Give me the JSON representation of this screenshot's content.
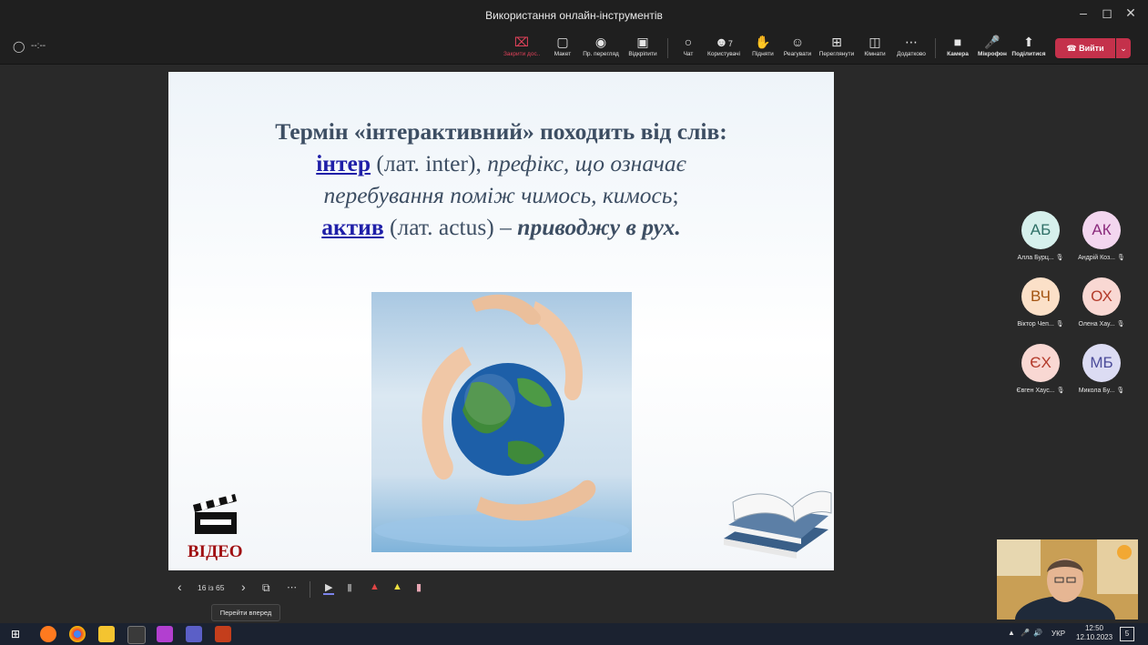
{
  "window": {
    "title": "Використання онлайн-інструментів"
  },
  "meeting": {
    "timer": "--:--"
  },
  "toolbar": {
    "close_share": "Закрити дос...",
    "layout": "Макет",
    "presenter_view": "Пр. перегляд",
    "unpin": "Відкріпити",
    "chat": "Чат",
    "people": "Користувачі",
    "people_count": "7",
    "raise": "Підняти",
    "react": "Реагувати",
    "view": "Переглянути",
    "rooms": "Кімнати",
    "more": "Додатково",
    "camera": "Камера",
    "mic": "Мікрофон",
    "share": "Поділитися",
    "leave": "Вийти"
  },
  "slide": {
    "line1": "Термін «інтерактивний» походить від слів:",
    "term1": "інтер",
    "term1_latin": " (лат. inter), ",
    "term1_def_a": "префікс, що означає",
    "term1_def_b": "перебування поміж чимось, кимось",
    "term1_def_end": ";",
    "term2": "актив",
    "term2_latin": " (лат. actus) – ",
    "term2_def": "приводжу в рух.",
    "video_label": "ВІДЕО"
  },
  "participants": [
    {
      "initials": "АБ",
      "name": "Алла Бурц...",
      "bg": "#d6f0ec",
      "fg": "#2e6f66"
    },
    {
      "initials": "АК",
      "name": "Андрій Коз...",
      "bg": "#f3d6ef",
      "fg": "#8a2a7c"
    },
    {
      "initials": "ВЧ",
      "name": "Віктор Чеп...",
      "bg": "#fbe0c8",
      "fg": "#a35412"
    },
    {
      "initials": "ОХ",
      "name": "Олена Хау...",
      "bg": "#f9d8d3",
      "fg": "#b33a2a"
    },
    {
      "initials": "ЄХ",
      "name": "Євген Хаус...",
      "bg": "#f9d8d3",
      "fg": "#b33a2a"
    },
    {
      "initials": "МБ",
      "name": "Микола Бу...",
      "bg": "#dcdcf3",
      "fg": "#4b4b99"
    }
  ],
  "presenter": {
    "slide_counter": "16 із 65",
    "tooltip": "Перейти вперед"
  },
  "taskbar": {
    "lang": "УКР",
    "time": "12:50",
    "date": "12.10.2023",
    "notif_count": "5"
  },
  "colors": {
    "leave": "#c4314b",
    "slide_heading": "#3d4e63",
    "slide_link": "#1f1fa8",
    "video_label": "#a00f12"
  }
}
